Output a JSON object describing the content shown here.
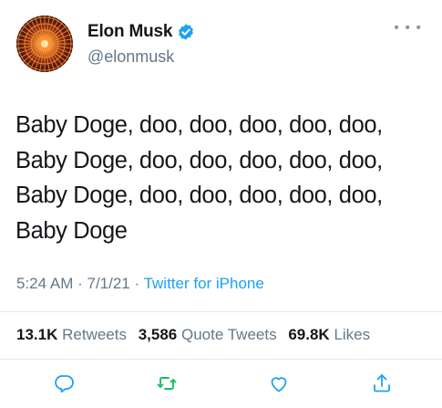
{
  "author": {
    "display_name": "Elon Musk",
    "handle": "@elonmusk",
    "verified_icon": "verified-badge-icon",
    "avatar_icon": "radial-lines-avatar"
  },
  "more_icon": "ellipsis-icon",
  "tweet": {
    "lines": [
      "Baby Doge, doo, doo, doo, doo, doo,",
      "Baby Doge, doo, doo, doo, doo, doo,",
      "Baby Doge, doo, doo, doo, doo, doo,",
      "Baby Doge"
    ]
  },
  "meta": {
    "time": "5:24 AM",
    "separator": " · ",
    "date": "7/1/21",
    "source": "Twitter for iPhone"
  },
  "stats": {
    "retweets_count": "13.1K",
    "retweets_label": "Retweets",
    "quote_count": "3,586",
    "quote_label": "Quote Tweets",
    "likes_count": "69.8K",
    "likes_label": "Likes"
  },
  "actions": {
    "reply_icon": "reply-icon",
    "retweet_icon": "retweet-icon",
    "like_icon": "heart-icon",
    "share_icon": "share-icon"
  },
  "colors": {
    "accent": "#1da1f2",
    "retweet_green": "#17bf63",
    "muted": "#657786",
    "text": "#14171a",
    "avatar_orange": "#e8641c"
  }
}
